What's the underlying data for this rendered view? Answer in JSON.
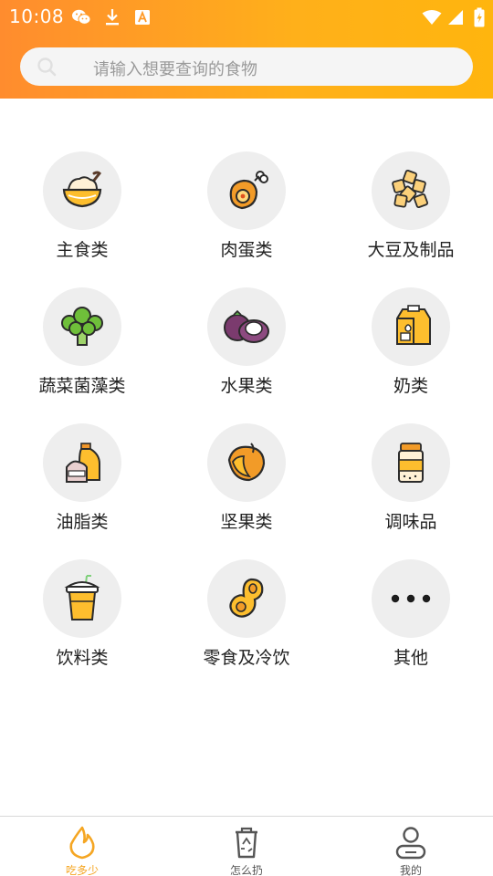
{
  "status_bar": {
    "time": "10:08"
  },
  "search": {
    "placeholder": "请输入想要查询的食物"
  },
  "categories": [
    {
      "label": "主食类",
      "icon": "rice-bowl-icon"
    },
    {
      "label": "肉蛋类",
      "icon": "drumstick-icon"
    },
    {
      "label": "大豆及制品",
      "icon": "tofu-icon"
    },
    {
      "label": "蔬菜菌藻类",
      "icon": "broccoli-icon"
    },
    {
      "label": "水果类",
      "icon": "mangosteen-icon"
    },
    {
      "label": "奶类",
      "icon": "milk-carton-icon"
    },
    {
      "label": "油脂类",
      "icon": "oil-bottle-icon"
    },
    {
      "label": "坚果类",
      "icon": "nut-icon"
    },
    {
      "label": "调味品",
      "icon": "spice-jar-icon"
    },
    {
      "label": "饮料类",
      "icon": "drink-cup-icon"
    },
    {
      "label": "零食及冷饮",
      "icon": "snack-icon"
    },
    {
      "label": "其他",
      "icon": "more-dots-icon"
    }
  ],
  "tabs": [
    {
      "label": "吃多少",
      "icon": "flame-icon",
      "active": true
    },
    {
      "label": "怎么扔",
      "icon": "recycle-bin-icon",
      "active": false
    },
    {
      "label": "我的",
      "icon": "user-icon",
      "active": false
    }
  ],
  "colors": {
    "accent": "#F5A623",
    "header_start": "#FF8C2E",
    "header_end": "#FFB50E",
    "icon_circle": "#EEEEEE"
  }
}
